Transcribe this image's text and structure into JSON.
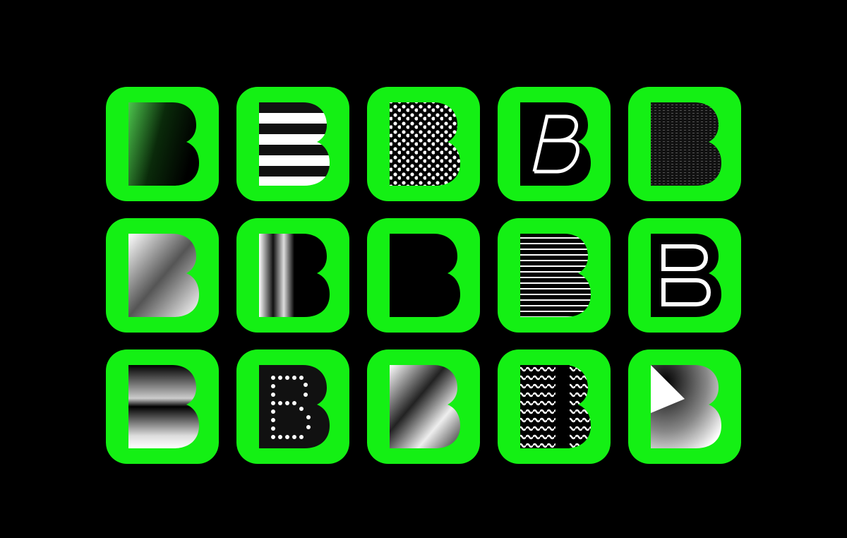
{
  "colors": {
    "background": "#000000",
    "tile": "#14f014",
    "ink": "#000000",
    "light": "#ffffff"
  },
  "tiles": [
    {
      "style": "green-gradient"
    },
    {
      "style": "horizontal-stripes"
    },
    {
      "style": "polka-dots"
    },
    {
      "style": "italic-outline"
    },
    {
      "style": "noise-texture"
    },
    {
      "style": "isometric-3d"
    },
    {
      "style": "vertical-light"
    },
    {
      "style": "solid-black"
    },
    {
      "style": "concentric-lines"
    },
    {
      "style": "outlined-d"
    },
    {
      "style": "chrome-horizontal"
    },
    {
      "style": "marquee-dots"
    },
    {
      "style": "metallic-outline"
    },
    {
      "style": "wavy-lines"
    },
    {
      "style": "radial-fold"
    }
  ]
}
